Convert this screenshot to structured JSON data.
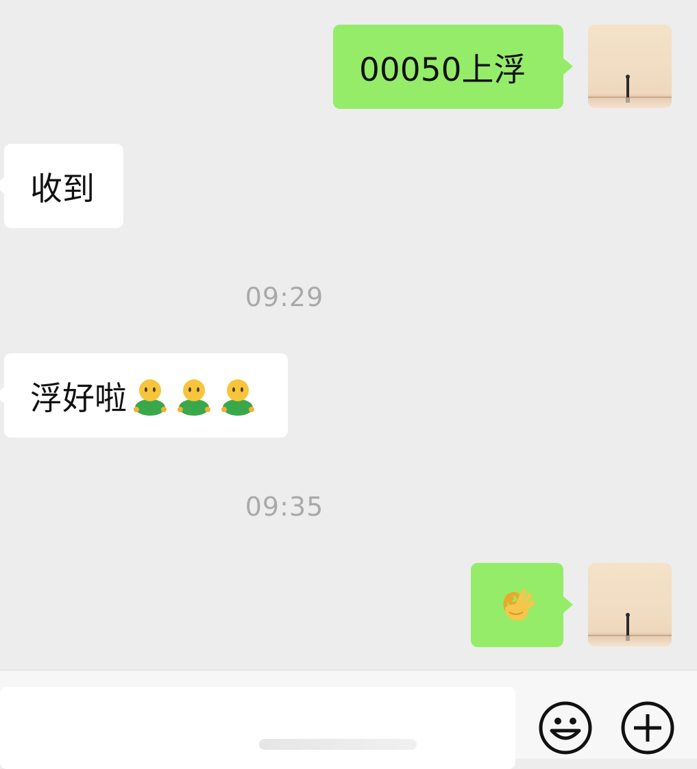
{
  "conversation": {
    "messages": [
      {
        "side": "sent",
        "text": "00050上浮"
      },
      {
        "side": "received",
        "text": "收到"
      },
      {
        "side": "received",
        "text": "浮好啦"
      },
      {
        "side": "sent",
        "emoji": "ok-hand"
      }
    ],
    "timestamps": [
      "09:29",
      "09:35"
    ]
  },
  "input_bar": {
    "emoji_button": "smile-icon",
    "more_button": "plus-icon"
  },
  "colors": {
    "background": "#ededed",
    "sent_bubble": "#95ec69",
    "received_bubble": "#ffffff",
    "timestamp_text": "#a9a9a9"
  }
}
